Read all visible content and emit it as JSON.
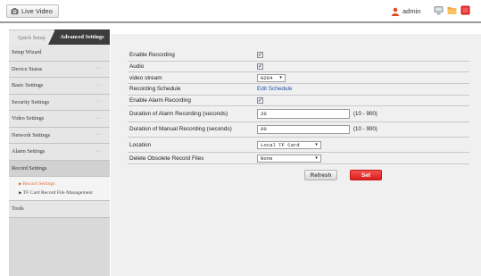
{
  "header": {
    "live_video_label": "Live Video",
    "user_name": "admin",
    "icons": [
      "camera-icon",
      "user-icon",
      "screen-icon",
      "folder-icon",
      "logout-icon"
    ],
    "colors": {
      "user": "#e14b22",
      "screen": "#9aa5a8",
      "folder": "#f3a53a",
      "logout": "#d21f1f"
    }
  },
  "sidebar": {
    "tabs": {
      "quick": "Quick Setup",
      "advanced": "Advanced Settings"
    },
    "items": [
      {
        "label": "Setup Wizard",
        "dots": ""
      },
      {
        "label": "Device Status",
        "dots": "···"
      },
      {
        "label": "Basic Settings",
        "dots": "···"
      },
      {
        "label": "Security Settings",
        "dots": "···"
      },
      {
        "label": "Video Settings",
        "dots": "···"
      },
      {
        "label": "Network Settings",
        "dots": "···"
      },
      {
        "label": "Alarm Settings",
        "dots": "···"
      },
      {
        "label": "Record Settings",
        "dots": ""
      },
      {
        "label": "Tools",
        "dots": ""
      }
    ],
    "sub_items": [
      {
        "label": "Record Settings",
        "arrow": "▶"
      },
      {
        "label": "TF Card Record File Management",
        "arrow": "▶"
      }
    ]
  },
  "form": {
    "enable_recording": {
      "label": "Enable Recording",
      "checked": "✓"
    },
    "audio": {
      "label": "Audio",
      "checked": "✓"
    },
    "video_stream": {
      "label": "video stream",
      "value": "H264"
    },
    "recording_schedule": {
      "label": "Recording Schedule",
      "link": "Edit Schedule"
    },
    "enable_alarm_recording": {
      "label": "Enable Alarm Recording",
      "checked": "✓"
    },
    "alarm_duration": {
      "label": "Duration of Alarm Recording (seconds)",
      "value": "20",
      "range": "(10 - 900)"
    },
    "manual_duration": {
      "label": "Duration of Manual Recording (seconds)",
      "value": "60",
      "range": "(10 - 900)"
    },
    "location": {
      "label": "Location",
      "value": "Local TF Card"
    },
    "delete_obsolete": {
      "label": "Delete Obsolete Record Files",
      "value": "None"
    },
    "buttons": {
      "refresh": "Refresh",
      "set": "Set"
    }
  }
}
